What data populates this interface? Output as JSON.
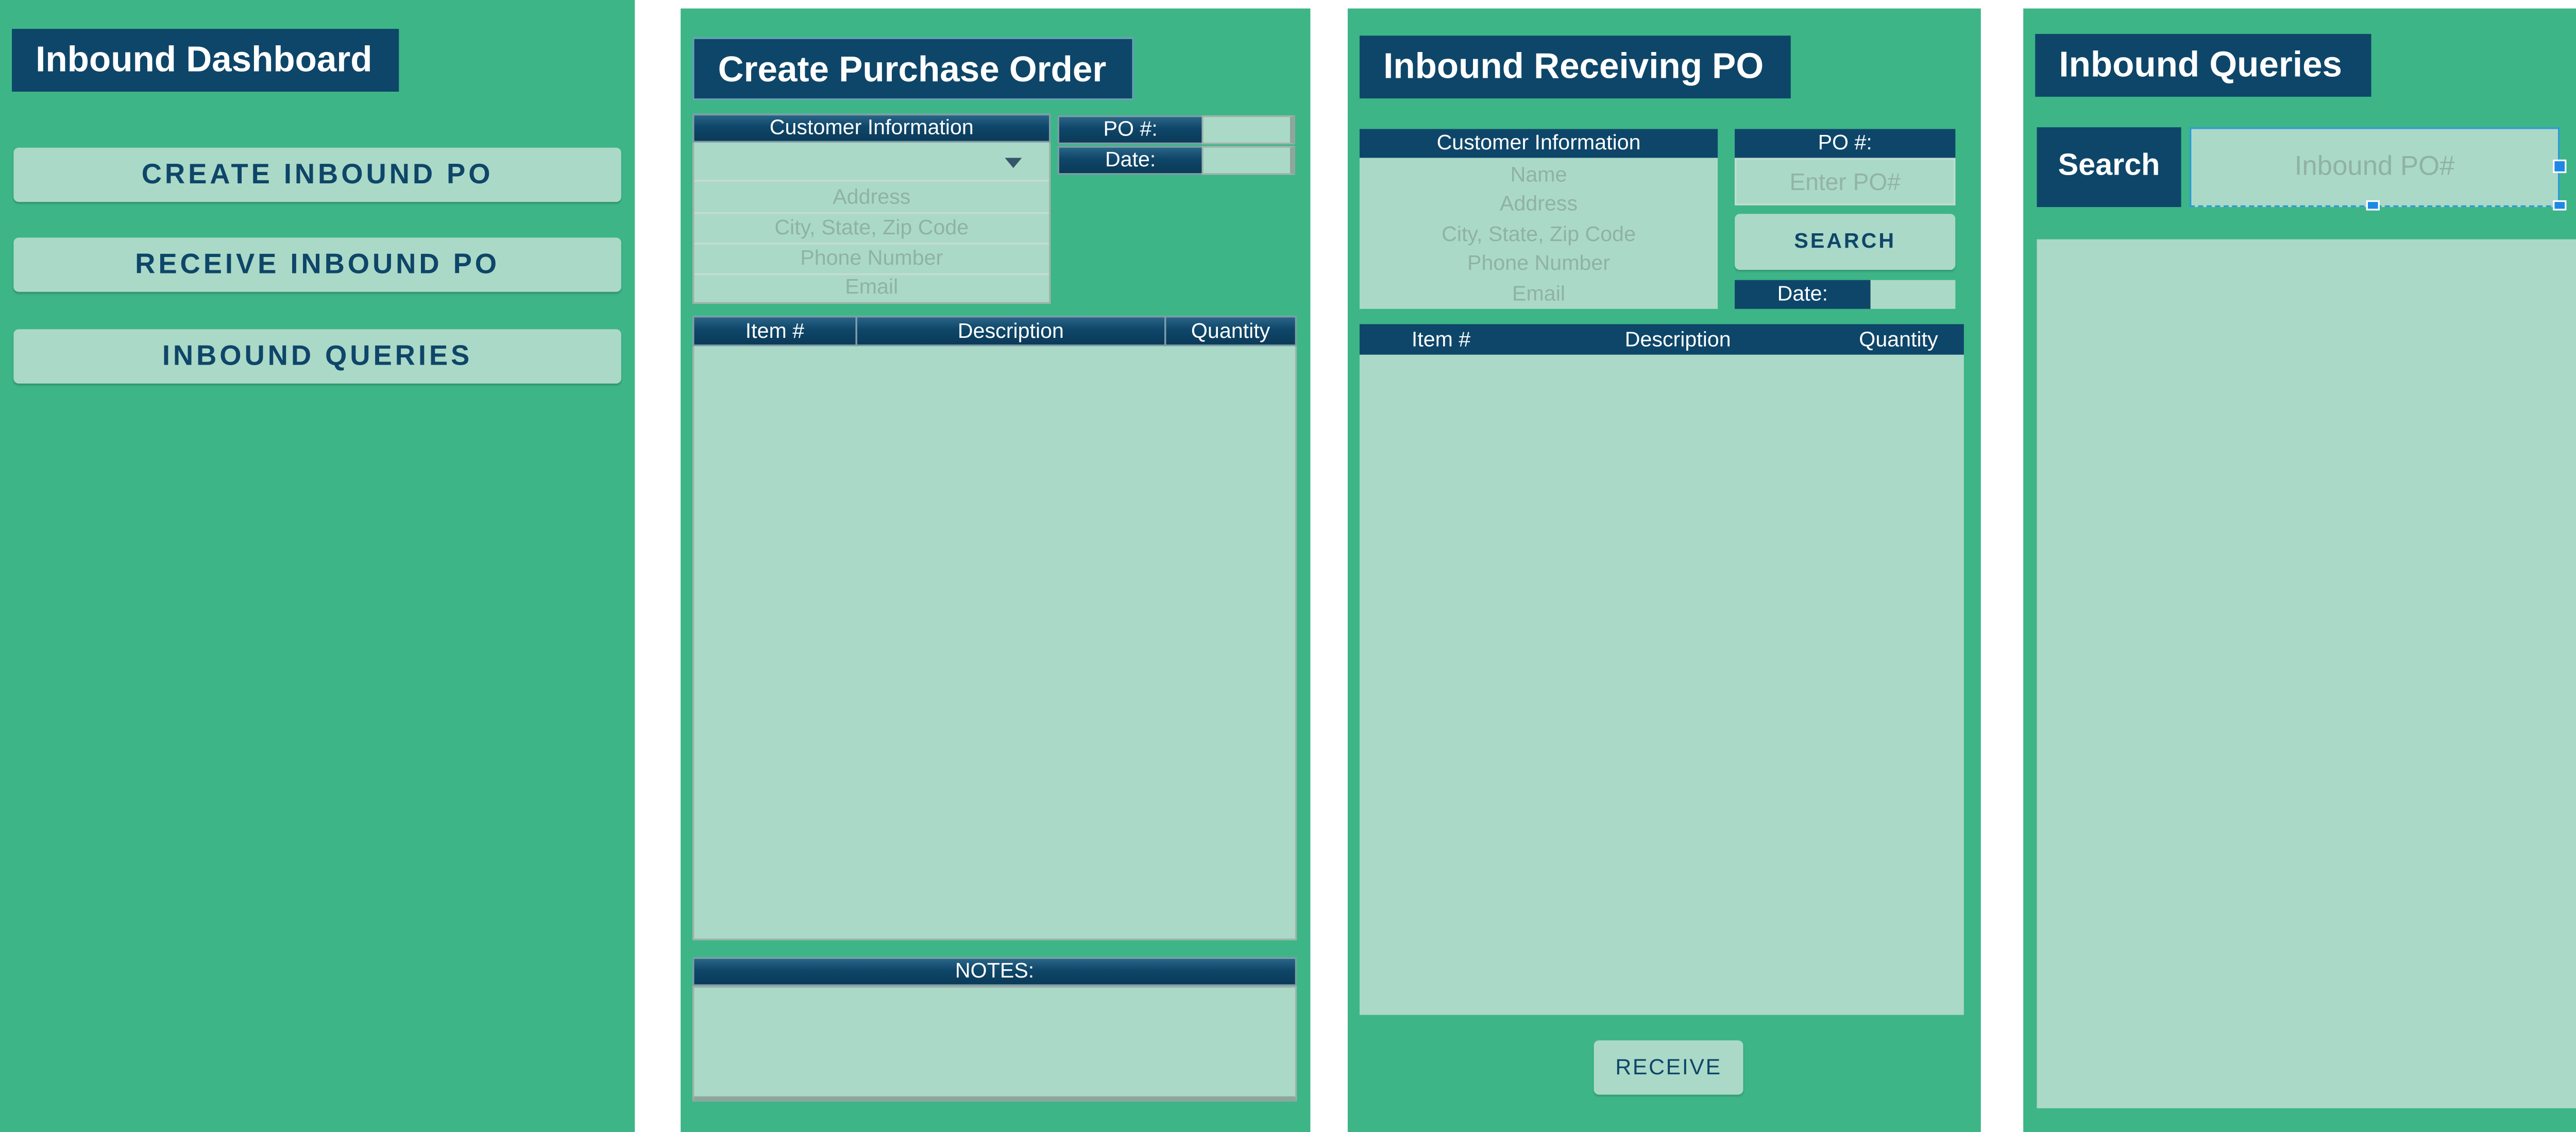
{
  "dashboard": {
    "title": "Inbound Dashboard",
    "buttons": [
      {
        "label": "CREATE INBOUND PO"
      },
      {
        "label": "RECEIVE INBOUND PO"
      },
      {
        "label": "INBOUND QUERIES"
      }
    ]
  },
  "create_po": {
    "title": "Create Purchase Order",
    "customer_header": "Customer Information",
    "customer_fields": [
      "Address",
      "City, State, Zip Code",
      "Phone Number",
      "Email"
    ],
    "po_label": "PO #:",
    "date_label": "Date:",
    "columns": [
      "Item #",
      "Description",
      "Quantity"
    ],
    "notes_label": "NOTES:"
  },
  "receiving_po": {
    "title": "Inbound Receiving PO",
    "customer_header": "Customer Information",
    "customer_fields": [
      "Name",
      "Address",
      "City, State, Zip Code",
      "Phone Number",
      "Email"
    ],
    "po_label": "PO #:",
    "po_placeholder": "Enter PO#",
    "search_label": "SEARCH",
    "date_label": "Date:",
    "columns": [
      "Item #",
      "Description",
      "Quantity"
    ],
    "receive_label": "RECEIVE"
  },
  "queries": {
    "title": "Inbound Queries",
    "search_label": "Search",
    "search_placeholder": "Inbound PO#",
    "search_icon": "magnifier-icon"
  },
  "colors": {
    "panel_green": "#3db587",
    "navy": "#0e4669",
    "light_green": "#abd9c7",
    "placeholder": "#8fb2a5",
    "selection_blue": "#1e88e5"
  }
}
